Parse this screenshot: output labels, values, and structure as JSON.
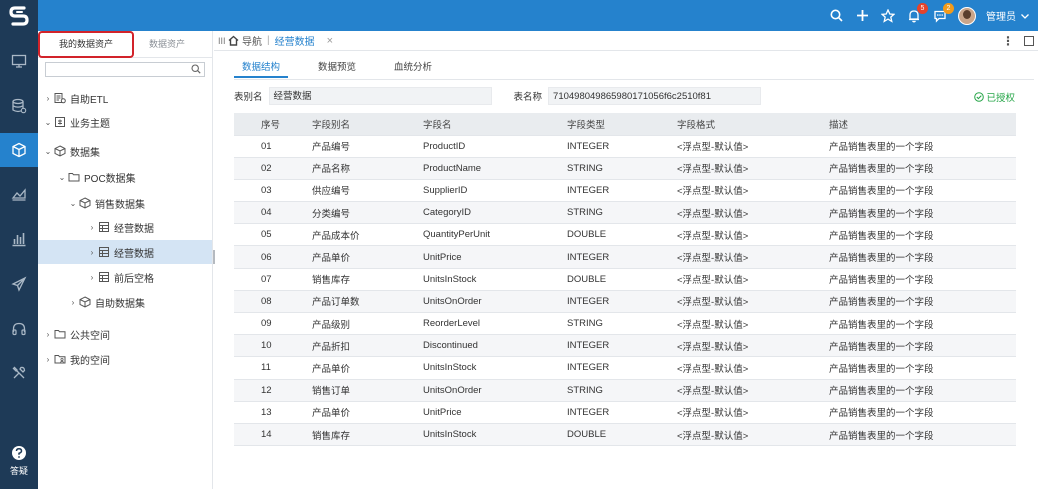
{
  "header": {
    "notification_count": "5",
    "message_count": "2",
    "user_name": "管理员",
    "icons": [
      "search-icon",
      "plus-icon",
      "star-icon",
      "bell-icon",
      "message-icon",
      "avatar",
      "chevron-down-icon"
    ],
    "colors": {
      "topbar": "#2582cd",
      "sidebar": "#1e3a57",
      "accent": "#2582cd",
      "highlight_border": "#d2232a",
      "auth_green": "#27a649"
    }
  },
  "leftnav": {
    "items": [
      "monitor-icon",
      "database-icon",
      "cube-icon",
      "chart-area-icon",
      "bar-chart-icon",
      "send-icon",
      "headset-icon",
      "tools-icon"
    ],
    "help_label": "答疑"
  },
  "tree_panel": {
    "tabs": [
      "我的数据资产",
      "数据资产"
    ],
    "search_placeholder": "",
    "nodes": [
      {
        "label": "自助ETL",
        "icon": "etl-icon"
      },
      {
        "label": "业务主题",
        "icon": "subject-icon"
      },
      {
        "label": "数据集",
        "icon": "cube-outline-icon"
      },
      {
        "label": "POC数据集",
        "icon": "folder-icon"
      },
      {
        "label": "销售数据集",
        "icon": "cube-outline-icon"
      },
      {
        "label": "经营数据",
        "icon": "table-icon"
      },
      {
        "label": "经营数据",
        "icon": "table-icon"
      },
      {
        "label": "前后空格",
        "icon": "table-icon"
      },
      {
        "label": "自助数据集",
        "icon": "cube-outline-icon"
      },
      {
        "label": "公共空间",
        "icon": "folder-icon"
      },
      {
        "label": "我的空间",
        "icon": "user-folder-icon"
      }
    ]
  },
  "content": {
    "tabs": {
      "nav_label": "导航",
      "active_tab": "经营数据"
    },
    "subtabs": [
      "数据结构",
      "数据预览",
      "血统分析"
    ],
    "table_alias_label": "表别名",
    "table_alias_value": "经营数据",
    "table_name_label": "表名称",
    "table_name_value": "710498049865980171056f6c2510f81",
    "auth_status": "已授权",
    "columns": [
      "序号",
      "字段别名",
      "字段名",
      "字段类型",
      "字段格式",
      "描述"
    ],
    "rows": [
      [
        "01",
        "产品编号",
        "ProductID",
        "INTEGER",
        "<浮点型-默认值>",
        "产品销售表里的一个字段"
      ],
      [
        "02",
        "产品名称",
        "ProductName",
        "STRING",
        "<浮点型-默认值>",
        "产品销售表里的一个字段"
      ],
      [
        "03",
        "供应编号",
        "SupplierID",
        "INTEGER",
        "<浮点型-默认值>",
        "产品销售表里的一个字段"
      ],
      [
        "04",
        "分类编号",
        "CategoryID",
        "STRING",
        "<浮点型-默认值>",
        "产品销售表里的一个字段"
      ],
      [
        "05",
        "产品成本价",
        "QuantityPerUnit",
        "DOUBLE",
        "<浮点型-默认值>",
        "产品销售表里的一个字段"
      ],
      [
        "06",
        "产品单价",
        "UnitPrice",
        "INTEGER",
        "<浮点型-默认值>",
        "产品销售表里的一个字段"
      ],
      [
        "07",
        "销售库存",
        "UnitsInStock",
        "DOUBLE",
        "<浮点型-默认值>",
        "产品销售表里的一个字段"
      ],
      [
        "08",
        "产品订单数",
        "UnitsOnOrder",
        "INTEGER",
        "<浮点型-默认值>",
        "产品销售表里的一个字段"
      ],
      [
        "09",
        "产品级别",
        "ReorderLevel",
        "STRING",
        "<浮点型-默认值>",
        "产品销售表里的一个字段"
      ],
      [
        "10",
        "产品折扣",
        "Discontinued",
        "INTEGER",
        "<浮点型-默认值>",
        "产品销售表里的一个字段"
      ],
      [
        "11",
        "产品单价",
        "UnitsInStock",
        "INTEGER",
        "<浮点型-默认值>",
        "产品销售表里的一个字段"
      ],
      [
        "12",
        "销售订单",
        "UnitsOnOrder",
        "STRING",
        "<浮点型-默认值>",
        "产品销售表里的一个字段"
      ],
      [
        "13",
        "产品单价",
        "UnitPrice",
        "INTEGER",
        "<浮点型-默认值>",
        "产品销售表里的一个字段"
      ],
      [
        "14",
        "销售库存",
        "UnitsInStock",
        "DOUBLE",
        "<浮点型-默认值>",
        "产品销售表里的一个字段"
      ]
    ]
  }
}
